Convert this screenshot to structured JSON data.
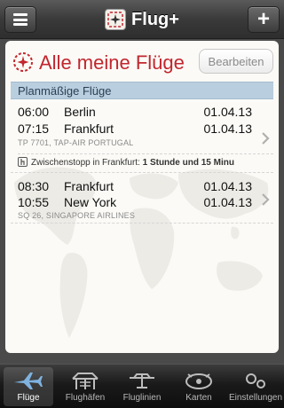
{
  "app": {
    "title": "Flug+"
  },
  "card": {
    "title": "Alle meine Flüge",
    "edit_label": "Bearbeiten",
    "section_label": "Planmäßige Flüge"
  },
  "flights": [
    {
      "dep_time": "06:00",
      "dep_city": "Berlin",
      "dep_date": "01.04.13",
      "arr_time": "07:15",
      "arr_city": "Frankfurt",
      "arr_date": "01.04.13",
      "airline": "TP 7701, TAP-AIR PORTUGAL",
      "stopover_prefix": "Zwischenstopp in Frankfurt: ",
      "stopover_duration": "1 Stunde und 15 Minu"
    },
    {
      "dep_time": "08:30",
      "dep_city": "Frankfurt",
      "dep_date": "01.04.13",
      "arr_time": "10:55",
      "arr_city": "New York",
      "arr_date": "01.04.13",
      "airline": "SQ 26, SINGAPORE AIRLINES"
    }
  ],
  "tabs": [
    {
      "label": "Flüge",
      "icon": "plane-icon",
      "active": true
    },
    {
      "label": "Flughäfen",
      "icon": "airport-icon",
      "active": false
    },
    {
      "label": "Fluglinien",
      "icon": "airline-icon",
      "active": false
    },
    {
      "label": "Karten",
      "icon": "map-icon",
      "active": false
    },
    {
      "label": "Einstellungen",
      "icon": "gear-icon",
      "active": false
    }
  ],
  "colors": {
    "accent_red": "#c2262e",
    "section_blue": "#b9cede",
    "bar_dark": "#2e2e2e"
  }
}
